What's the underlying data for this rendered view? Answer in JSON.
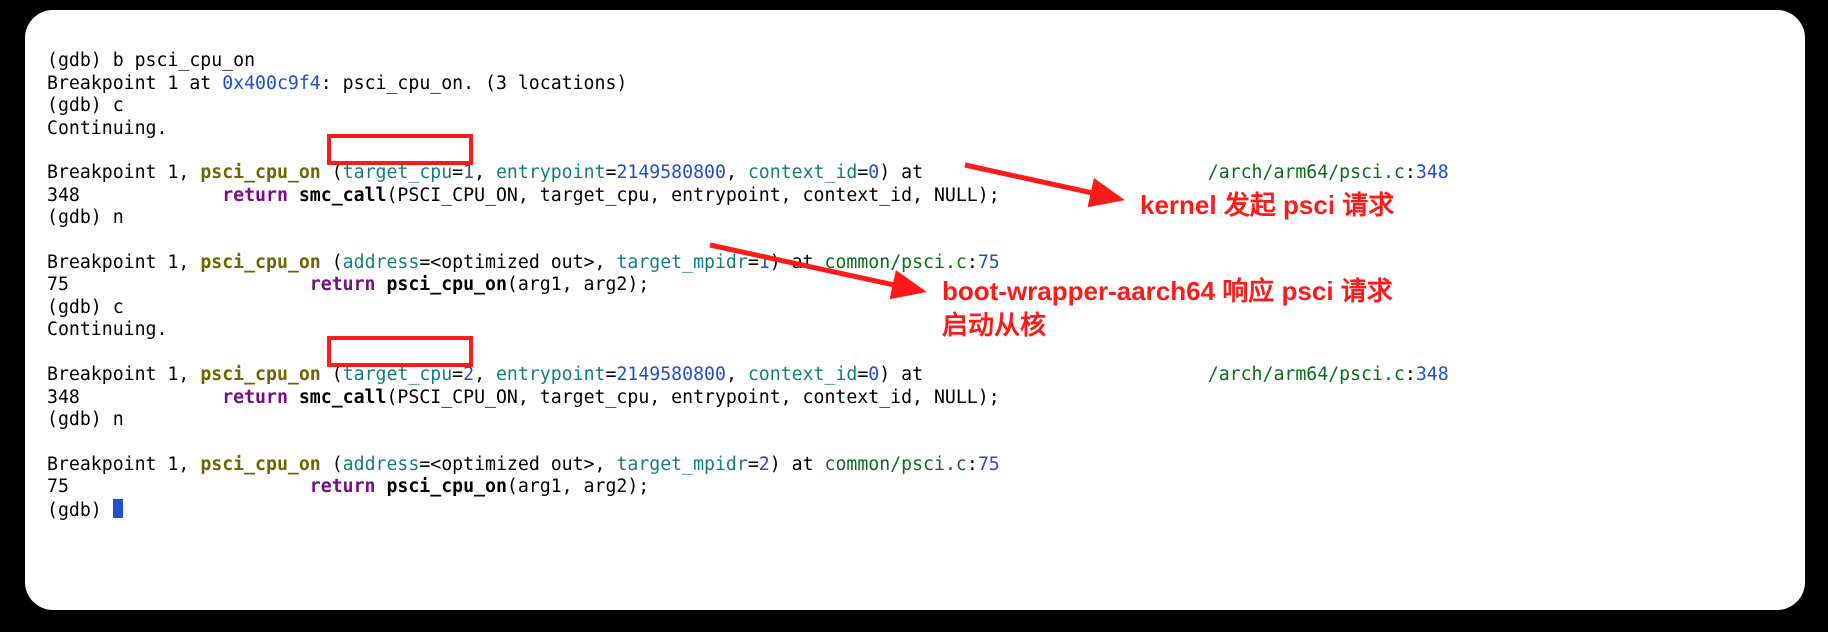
{
  "terminal": {
    "l1_prompt": "(gdb) ",
    "l1_cmd": "b psci_cpu_on",
    "l2_a": "Breakpoint 1 at ",
    "l2_addr": "0x400c9f4",
    "l2_b": ": psci_cpu_on. (3 locations)",
    "l3_prompt": "(gdb) ",
    "l3_cmd": "c",
    "l4": "Continuing.",
    "l5": "",
    "l6_a": "Breakpoint 1, ",
    "l6_fn": "psci_cpu_on",
    "l6_b": " (",
    "l6_p1": "target_cpu",
    "l6_eq1": "=",
    "l6_v1": "1",
    "l6_c1": ", ",
    "l6_p2": "entrypoint",
    "l6_eq2": "=",
    "l6_v2": "2149580800",
    "l6_c2": ", ",
    "l6_p3": "context_id",
    "l6_eq3": "=",
    "l6_v3": "0",
    "l6_d": ") at ",
    "l6_path": "/arch/arm64/psci.c",
    "l6_colon": ":",
    "l6_line": "348",
    "l7_a": "348             ",
    "l7_kw": "return",
    "l7_b": " ",
    "l7_fn": "smc_call",
    "l7_c": "(PSCI_CPU_ON, target_cpu, entrypoint, context_id, NULL);",
    "l8_prompt": "(gdb) ",
    "l8_cmd": "n",
    "l9": "",
    "l10_a": "Breakpoint 1, ",
    "l10_fn": "psci_cpu_on",
    "l10_b": " (",
    "l10_p1": "address",
    "l10_eq1": "=<optimized out>, ",
    "l10_p2": "target_mpidr",
    "l10_eq2": "=",
    "l10_v2": "1",
    "l10_d": ") at ",
    "l10_path": "common/psci.c",
    "l10_colon": ":",
    "l10_line": "75",
    "l11_a": "75                      ",
    "l11_kw": "return",
    "l11_b": " ",
    "l11_fn": "psci_cpu_on",
    "l11_c": "(arg1, arg2);",
    "l12_prompt": "(gdb) ",
    "l12_cmd": "c",
    "l13": "Continuing.",
    "l14": "",
    "l15_a": "Breakpoint 1, ",
    "l15_fn": "psci_cpu_on",
    "l15_b": " (",
    "l15_p1": "target_cpu",
    "l15_eq1": "=",
    "l15_v1": "2",
    "l15_c1": ", ",
    "l15_p2": "entrypoint",
    "l15_eq2": "=",
    "l15_v2": "2149580800",
    "l15_c2": ", ",
    "l15_p3": "context_id",
    "l15_eq3": "=",
    "l15_v3": "0",
    "l15_d": ") at ",
    "l15_path": "/arch/arm64/psci.c",
    "l15_colon": ":",
    "l15_line": "348",
    "l16_a": "348             ",
    "l16_kw": "return",
    "l16_b": " ",
    "l16_fn": "smc_call",
    "l16_c": "(PSCI_CPU_ON, target_cpu, entrypoint, context_id, NULL);",
    "l17_prompt": "(gdb) ",
    "l17_cmd": "n",
    "l18": "",
    "l19_a": "Breakpoint 1, ",
    "l19_fn": "psci_cpu_on",
    "l19_b": " (",
    "l19_p1": "address",
    "l19_eq1": "=<optimized out>, ",
    "l19_p2": "target_mpidr",
    "l19_eq2": "=",
    "l19_v2": "2",
    "l19_d": ") at ",
    "l19_path": "common/psci.c",
    "l19_colon": ":",
    "l19_line": "75",
    "l20_a": "75                      ",
    "l20_kw": "return",
    "l20_b": " ",
    "l20_fn": "psci_cpu_on",
    "l20_c": "(arg1, arg2);",
    "l21_prompt": "(gdb) "
  },
  "annotations": {
    "a1": "kernel 发起 psci 请求",
    "a2": "boot-wrapper-aarch64 响应 psci 请求\n启动从核"
  }
}
